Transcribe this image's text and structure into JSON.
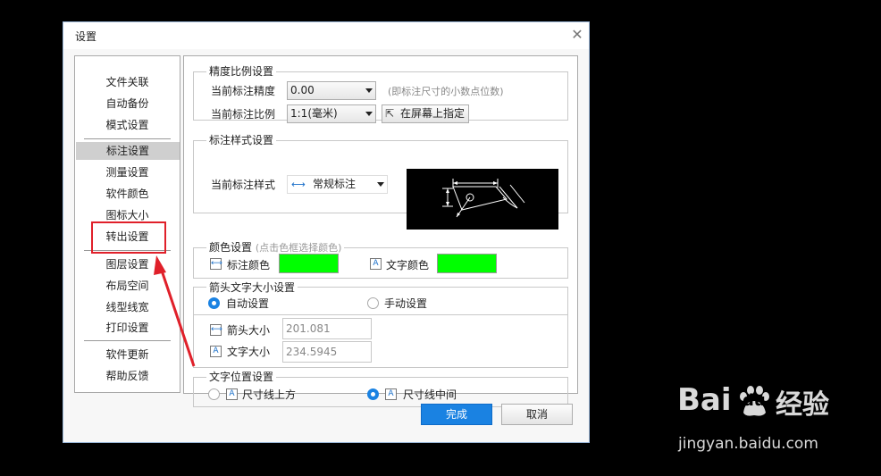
{
  "dialog": {
    "title": "设置",
    "close_glyph": "✕"
  },
  "sidebar": {
    "items": [
      {
        "label": "文件关联"
      },
      {
        "label": "自动备份"
      },
      {
        "label": "模式设置"
      },
      {
        "label": "标注设置"
      },
      {
        "label": "测量设置"
      },
      {
        "label": "软件颜色"
      },
      {
        "label": "图标大小"
      },
      {
        "label": "转出设置"
      },
      {
        "label": "图层设置"
      },
      {
        "label": "布局空间"
      },
      {
        "label": "线型线宽"
      },
      {
        "label": "打印设置"
      },
      {
        "label": "软件更新"
      },
      {
        "label": "帮助反馈"
      }
    ],
    "selected": "标注设置"
  },
  "precision": {
    "legend": "精度比例设置",
    "precision_label": "当前标注精度",
    "precision_value": "0.00",
    "precision_hint": "(即标注尺寸的小数点位数)",
    "scale_label": "当前标注比例",
    "scale_value": "1:1(毫米)",
    "pick_button": "在屏幕上指定"
  },
  "style": {
    "legend": "标注样式设置",
    "style_label": "当前标注样式",
    "style_value": "常规标注"
  },
  "color": {
    "legend": "颜色设置",
    "legend_hint": "(点击色框选择颜色)",
    "dim_label": "标注颜色",
    "text_label": "文字颜色",
    "dim_color": "#00ff00",
    "text_color": "#00ff00"
  },
  "size": {
    "legend": "箭头文字大小设置",
    "auto_label": "自动设置",
    "manual_label": "手动设置",
    "mode": "auto",
    "arrow_label": "箭头大小",
    "arrow_value": "201.081",
    "text_label": "文字大小",
    "text_value": "234.5945"
  },
  "position": {
    "legend": "文字位置设置",
    "above_label": "尺寸线上方",
    "middle_label": "尺寸线中间",
    "mode": "middle"
  },
  "footer": {
    "ok_label": "完成",
    "cancel_label": "取消"
  },
  "watermark": {
    "brand_a": "Bai",
    "brand_b": "du",
    "brand_c": "经验",
    "url": "jingyan.baidu.com"
  },
  "annotation": {
    "color": "#e0202a"
  }
}
